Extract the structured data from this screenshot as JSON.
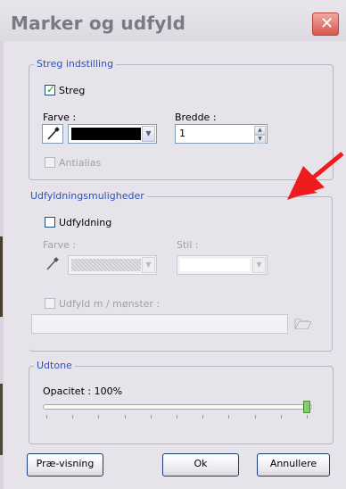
{
  "dialog": {
    "title": "Marker og udfyld",
    "close_glyph": "✕"
  },
  "stroke_group": {
    "legend": "Streg indstilling",
    "stroke_checkbox_label": "Streg",
    "stroke_checked": true,
    "color_label": "Farve :",
    "color_value": "#000000",
    "width_label": "Bredde :",
    "width_value": "1",
    "antialias_label": "Antialias",
    "antialias_checked": false
  },
  "fill_group": {
    "legend": "Udfyldningsmuligheder",
    "fill_checkbox_label": "Udfyldning",
    "fill_checked": false,
    "color_label": "Farve :",
    "style_label": "Stil :",
    "pattern_label": "Udfyld m / mønster :",
    "pattern_checked": false,
    "pattern_path": ""
  },
  "tone_group": {
    "legend": "Udtone",
    "opacity_label": "Opacitet : 100%",
    "opacity_fraction": 1.0
  },
  "buttons": {
    "preview": "Præ-visning",
    "ok": "Ok",
    "cancel": "Annullere"
  },
  "icons": {
    "eyedropper": "eyedropper-icon",
    "folder": "folder-open-icon",
    "dropdown": "chevron-down-icon",
    "annotation_arrow": "red-arrow-icon"
  },
  "colors": {
    "legend_text": "#2d52b6",
    "arrow": "#ee1c1c",
    "window_bg": "#e7e3ea"
  }
}
